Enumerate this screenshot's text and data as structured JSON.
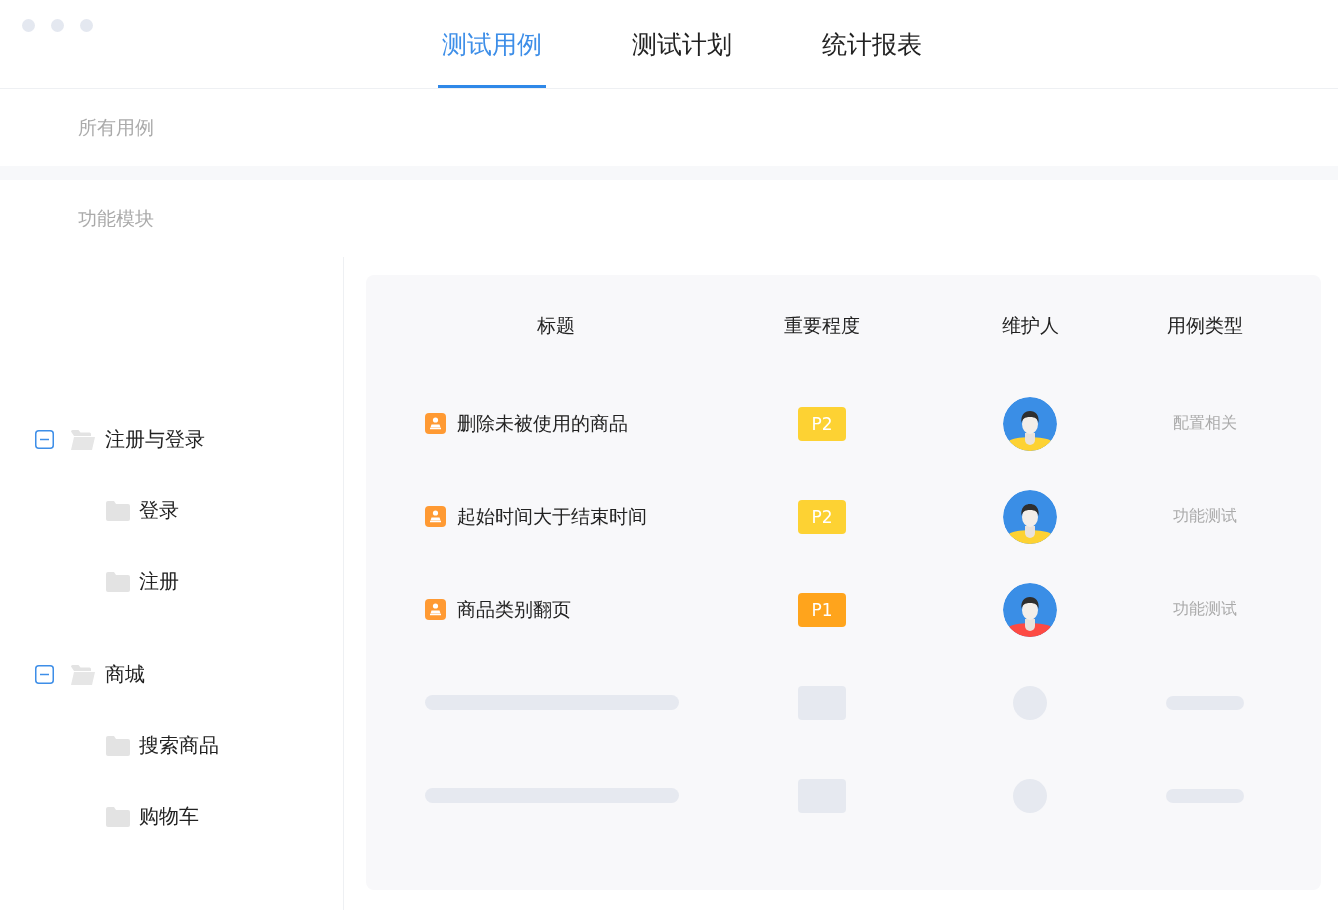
{
  "tabs": [
    {
      "label": "测试用例",
      "selected": true
    },
    {
      "label": "测试计划",
      "selected": false
    },
    {
      "label": "统计报表",
      "selected": false
    }
  ],
  "sections": [
    "所有用例",
    "功能模块"
  ],
  "tree": [
    {
      "label": "注册与登录",
      "expanded": true,
      "children": [
        {
          "label": "登录"
        },
        {
          "label": "注册"
        }
      ]
    },
    {
      "label": "商城",
      "expanded": true,
      "children": [
        {
          "label": "搜索商品"
        },
        {
          "label": "购物车"
        }
      ]
    }
  ],
  "table": {
    "columns": [
      "标题",
      "重要程度",
      "维护人",
      "用例类型"
    ],
    "rows": [
      {
        "kind": "case",
        "title": "删除未被使用的商品",
        "priority": {
          "label": "P2",
          "color": "#fdd233"
        },
        "maintainer": {
          "color": "#fdd233"
        },
        "type": "配置相关"
      },
      {
        "kind": "case",
        "title": "起始时间大于结束时间",
        "priority": {
          "label": "P2",
          "color": "#fdd233"
        },
        "maintainer": {
          "color": "#fdd233"
        },
        "type": "功能测试"
      },
      {
        "kind": "case",
        "title": "商品类别翻页",
        "priority": {
          "label": "P1",
          "color": "#ffa41c"
        },
        "maintainer": {
          "color": "#fd4a43"
        },
        "type": "功能测试"
      },
      {
        "kind": "skeleton"
      },
      {
        "kind": "skeleton"
      }
    ]
  }
}
